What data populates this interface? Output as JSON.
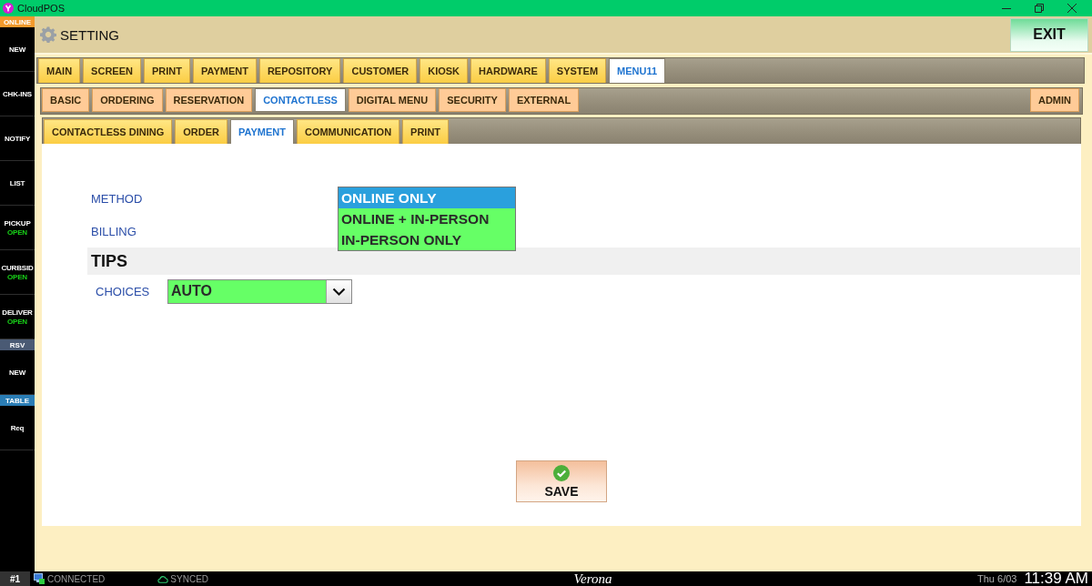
{
  "window": {
    "title": "CloudPOS"
  },
  "sidebar": {
    "status": "ONLINE",
    "items": [
      {
        "kind": "button",
        "label": "NEW"
      },
      {
        "kind": "button",
        "label": "CHK-INS"
      },
      {
        "kind": "button",
        "label": "NOTIFY"
      },
      {
        "kind": "button",
        "label": "LIST"
      },
      {
        "kind": "button",
        "label": "PICKUP",
        "status": "OPEN"
      },
      {
        "kind": "button",
        "label": "CURBSID",
        "status": "OPEN"
      },
      {
        "kind": "button",
        "label": "DELIVER",
        "status": "OPEN"
      },
      {
        "kind": "header",
        "label": "RSV",
        "color": "#4a5a74"
      },
      {
        "kind": "button",
        "label": "NEW"
      },
      {
        "kind": "header",
        "label": "TABLE",
        "color": "#2a7db5"
      },
      {
        "kind": "button",
        "label": "Req"
      }
    ]
  },
  "header": {
    "title": "SETTING",
    "exit_button": "EXIT"
  },
  "tabs": [
    {
      "label": "MAIN",
      "selected": false
    },
    {
      "label": "SCREEN",
      "selected": false
    },
    {
      "label": "PRINT",
      "selected": false
    },
    {
      "label": "PAYMENT",
      "selected": false
    },
    {
      "label": "REPOSITORY",
      "selected": false
    },
    {
      "label": "CUSTOMER",
      "selected": false
    },
    {
      "label": "KIOSK",
      "selected": false
    },
    {
      "label": "HARDWARE",
      "selected": false
    },
    {
      "label": "SYSTEM",
      "selected": false
    },
    {
      "label": "MENU11",
      "selected": true
    }
  ],
  "subtabs": [
    {
      "label": "BASIC",
      "selected": false
    },
    {
      "label": "ORDERING",
      "selected": false
    },
    {
      "label": "RESERVATION",
      "selected": false
    },
    {
      "label": "CONTACTLESS",
      "selected": true
    },
    {
      "label": "DIGITAL MENU",
      "selected": false
    },
    {
      "label": "SECURITY",
      "selected": false
    },
    {
      "label": "EXTERNAL",
      "selected": false
    }
  ],
  "subtabs_right": [
    {
      "label": "ADMIN",
      "selected": false
    }
  ],
  "section_tabs": [
    {
      "label": "CONTACTLESS DINING",
      "selected": false
    },
    {
      "label": "ORDER",
      "selected": false
    },
    {
      "label": "PAYMENT",
      "selected": true
    },
    {
      "label": "COMMUNICATION",
      "selected": false
    },
    {
      "label": "PRINT",
      "selected": false
    }
  ],
  "form": {
    "fields": [
      {
        "label": "METHOD"
      },
      {
        "label": "BILLING"
      }
    ],
    "method_options": [
      {
        "label": "ONLINE ONLY",
        "selected": true
      },
      {
        "label": "ONLINE + IN-PERSON",
        "selected": false
      },
      {
        "label": "IN-PERSON ONLY",
        "selected": false
      }
    ],
    "tips": {
      "title": "TIPS",
      "fields": [
        {
          "label": "CHOICES",
          "value": "AUTO"
        }
      ]
    }
  },
  "save_button": "SAVE",
  "status_bar": {
    "terminal": "#1",
    "connection": "CONNECTED",
    "sync": "SYNCED",
    "location": "Verona",
    "date": "Thu 6/03",
    "time": "11:39 AM"
  }
}
